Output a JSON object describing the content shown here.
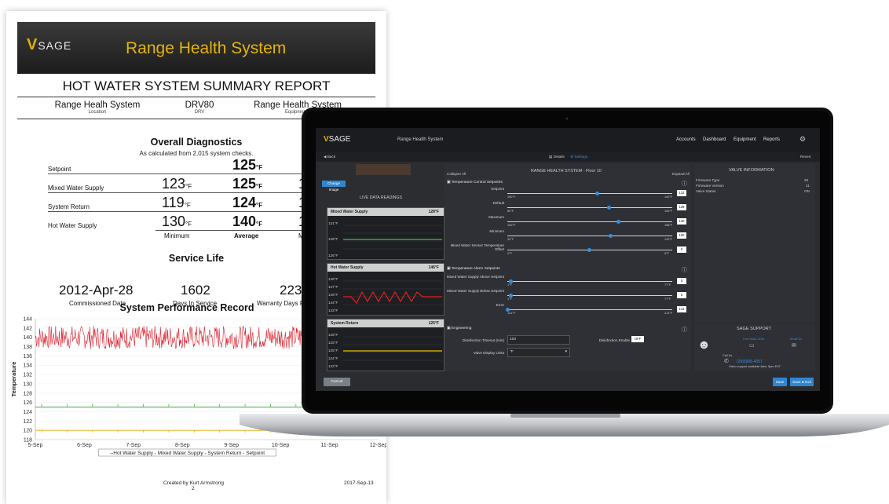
{
  "report": {
    "brand": "SAGE",
    "header_title": "Range Health System",
    "title": "HOT WATER SYSTEM SUMMARY REPORT",
    "meta": [
      {
        "value": "Range Healh System",
        "caption": "Location"
      },
      {
        "value": "DRV80",
        "caption": "DRV"
      },
      {
        "value": "Range Health System",
        "caption": "Equipment I"
      }
    ],
    "diagnostics": {
      "title": "Overall Diagnostics",
      "subtitle": "As calculated from 2,015 system checks.",
      "rows": [
        {
          "label": "Setpoint",
          "min": "",
          "avg": "125",
          "max": ""
        },
        {
          "label": "Mixed Water Supply",
          "min": "123",
          "avg": "125",
          "max": "1"
        },
        {
          "label": "System Return",
          "min": "119",
          "avg": "124",
          "max": "1"
        },
        {
          "label": "Hot Water Supply",
          "min": "130",
          "avg": "140",
          "max": "1"
        }
      ],
      "unit": "°F",
      "col_min": "Minimum",
      "col_avg": "Average",
      "col_max": "M"
    },
    "service_life": {
      "title": "Service Life",
      "commissioned": "2012-Apr-28",
      "commissioned_label": "Commissioned Date",
      "days": "1602",
      "days_label": "Days In Service",
      "warranty": "223",
      "warranty_label": "Warranty Days R"
    },
    "performance_title": "System Performance Record",
    "footer_created": "Created by Kurt Armstrong",
    "footer_page": "2",
    "footer_date": "2017-Sep-13"
  },
  "chart_data": {
    "type": "line",
    "title": "System Performance Record",
    "ylabel": "Temperature",
    "ylim": [
      118,
      144
    ],
    "yticks": [
      118,
      120,
      122,
      124,
      126,
      128,
      130,
      132,
      134,
      136,
      138,
      140,
      142,
      144
    ],
    "categories": [
      "5-Sep",
      "6-Sep",
      "7-Sep",
      "8-Sep",
      "9-Sep",
      "10-Sep",
      "11-Sep",
      "12-Sep"
    ],
    "legend": "--Hot Water Supply - Mixed Water Supply - System Return - Setpoint",
    "series": [
      {
        "name": "Hot Water Supply",
        "color": "#d9202e",
        "values": [
          140,
          140,
          140,
          140,
          140,
          140,
          140,
          140
        ]
      },
      {
        "name": "Mixed Water Supply",
        "color": "#3fae3f",
        "values": [
          125,
          125,
          125,
          125,
          125,
          125,
          125,
          125
        ]
      },
      {
        "name": "System Return",
        "color": "#e8a800",
        "values": [
          120,
          120,
          120,
          120,
          120,
          120,
          120,
          120
        ]
      }
    ]
  },
  "app": {
    "brand": "SAGE",
    "title": "Range Health System",
    "nav": [
      "Accounts",
      "Dashboard",
      "Equipment",
      "Reports"
    ],
    "back": "Back",
    "tab_details": "Details",
    "tab_settings": "Settings",
    "revert": "Revert",
    "change_image": "Change Image",
    "live_title": "LIVE DATA READINGS",
    "graphs": [
      {
        "name": "Mixed Water Supply",
        "value": "128°F",
        "ticks": [
          "131°F",
          "128°F",
          "126°F"
        ],
        "color": "#3fc03f"
      },
      {
        "name": "Hot Water Supply",
        "value": "146°F",
        "ticks": [
          "148°F",
          "147°F",
          "146°F",
          "144°F",
          "143°F"
        ],
        "color": "#e02020"
      },
      {
        "name": "System Return",
        "value": "125°F",
        "ticks": [
          "128°F",
          "126°F",
          "125°F",
          "124°F",
          "123°F"
        ],
        "color": "#e8c000"
      }
    ],
    "collapse_all": "Collapse All",
    "expand_all": "Expand All",
    "settings_title": "RANGE HEALTH SYSTEM - Floor 10",
    "temp_control": {
      "title": "Temperature Control Setpoints",
      "rows": [
        {
          "label": "Setpoint",
          "min": "100°F",
          "max": "140°F",
          "value": "122",
          "pos": 0.55
        },
        {
          "label": "Default",
          "min": "80°F",
          "max": "154°F",
          "value": "128",
          "pos": 0.62
        },
        {
          "label": "Maximum",
          "min": "100°F",
          "max": "158°F",
          "value": "140",
          "pos": 0.68
        },
        {
          "label": "Minimum",
          "min": "32°F",
          "max": "140°F",
          "value": "100",
          "pos": 0.63
        },
        {
          "label": "Mixed Water Sensor Temperature Offset",
          "min": "0°F",
          "max": "9°F",
          "value": "0",
          "pos": 0.5
        }
      ]
    },
    "temp_alarm": {
      "title": "Temperature Alarm Setpoints",
      "rows": [
        {
          "label": "Mixed Water Supply Above Setpoint",
          "min": "1°F",
          "max": "77°F",
          "value": "5",
          "pos": 0.02
        },
        {
          "label": "Mixed Water Supply Below Setpoint",
          "min": "1°F",
          "max": "77°F",
          "value": "5",
          "pos": 0.02
        },
        {
          "label": "Error",
          "min": "141°F",
          "max": "212°F",
          "value": "141",
          "pos": 0.0
        }
      ]
    },
    "engineering": {
      "title": "Engineering",
      "timeout_label": "Disinfection Timeout (min)",
      "timeout_value": "100",
      "enable_label": "Disinfection Enable",
      "enable_value": "OFF",
      "units_label": "Valve Display Units",
      "units_value": "°F"
    },
    "valve_info": {
      "title": "VALVE INFORMATION",
      "rows": [
        {
          "k": "Firmware Type",
          "v": "26"
        },
        {
          "k": "Firmware Version",
          "v": "11"
        },
        {
          "k": "Valve Status",
          "v": "ON"
        }
      ]
    },
    "support": {
      "title": "SAGE SUPPORT",
      "live_chat": "Live Video Chat",
      "email": "Email Us",
      "call": "Call Us",
      "phone": "(269)965-4057",
      "hours": "Video support available 8am- 5pm EST"
    },
    "cancel": "Cancel",
    "save": "Save",
    "save_exit": "Save & Exit"
  }
}
